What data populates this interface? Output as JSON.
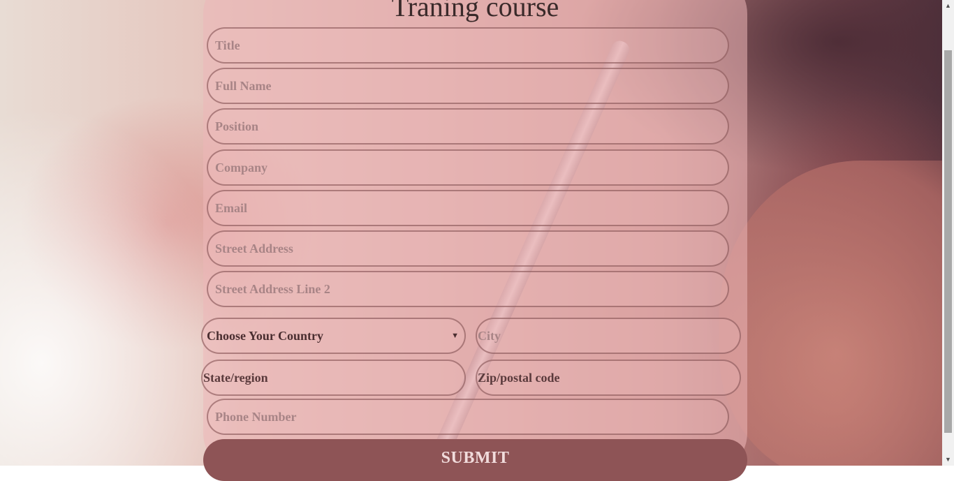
{
  "page": {
    "title": "Traning course"
  },
  "form": {
    "title_placeholder": "Title",
    "full_name_placeholder": "Full Name",
    "position_placeholder": "Position",
    "company_placeholder": "Company",
    "email_placeholder": "Email",
    "street_address_placeholder": "Street Address",
    "street_address_2_placeholder": "Street Address Line 2",
    "country_select": {
      "selected": "Choose Your Country",
      "caret": "▼"
    },
    "city_placeholder": "City",
    "state_placeholder": "State/region",
    "zip_placeholder": "Zip/postal code",
    "phone_placeholder": "Phone Number",
    "submit_label": "SUBMIT"
  },
  "scrollbar": {
    "up_arrow": "▲",
    "down_arrow": "▼"
  },
  "colors": {
    "card": "#ecb6b8",
    "submit": "#8e5456",
    "placeholder": "#a88486"
  }
}
